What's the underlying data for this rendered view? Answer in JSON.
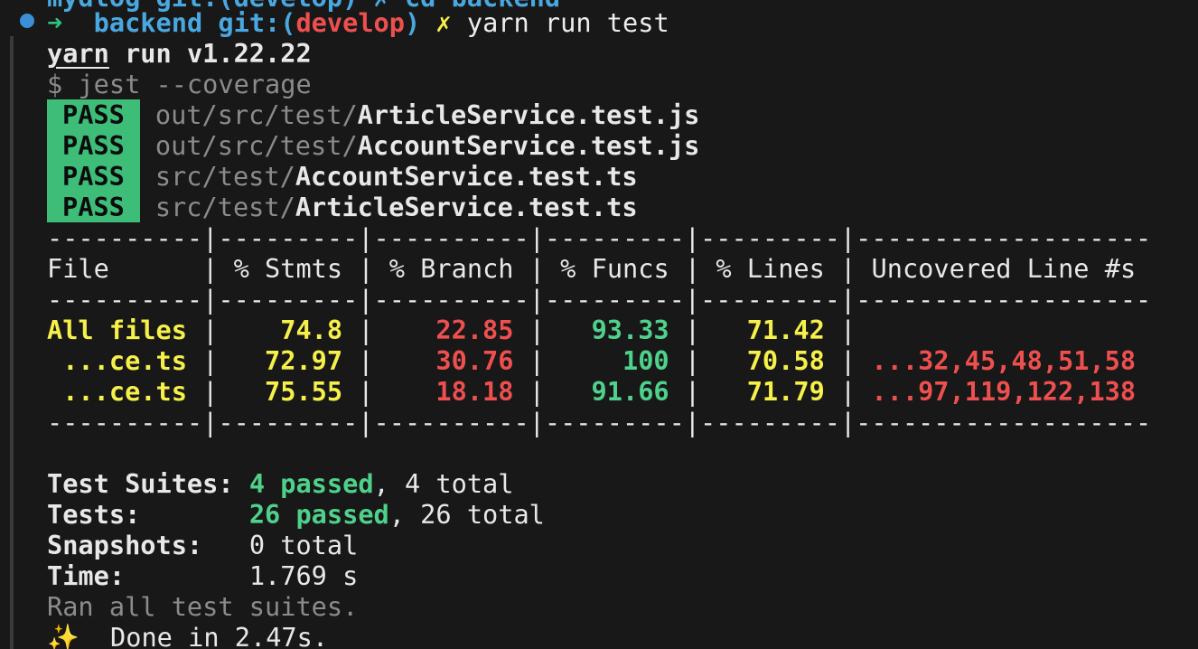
{
  "prev_command": "mydlog git:(develop) ✗ cd backend",
  "prompt": {
    "arrow": "➜",
    "dir": "backend",
    "git_label": "git:(",
    "branch": "develop",
    "git_close": ")",
    "dirty": "✗",
    "command": "yarn run test"
  },
  "yarn_header": {
    "yarn": "yarn",
    "rest": " run v1.22.22"
  },
  "jest_cmd": "$ jest --coverage",
  "test_results": [
    {
      "status": "PASS",
      "dir": "out/src/test/",
      "file": "ArticleService.test.js"
    },
    {
      "status": "PASS",
      "dir": "out/src/test/",
      "file": "AccountService.test.js"
    },
    {
      "status": "PASS",
      "dir": "src/test/",
      "file": "AccountService.test.ts"
    },
    {
      "status": "PASS",
      "dir": "src/test/",
      "file": "ArticleService.test.ts"
    }
  ],
  "coverage": {
    "separator": "----------|---------|----------|---------|---------|-------------------",
    "headers": [
      "File",
      "% Stmts",
      "% Branch",
      "% Funcs",
      "% Lines",
      "Uncovered Line #s"
    ],
    "rows": [
      {
        "file": "All files",
        "stmts": "74.8",
        "branch": "22.85",
        "funcs": "93.33",
        "lines": "71.42",
        "uncovered": ""
      },
      {
        "file": " ...ce.ts",
        "stmts": "72.97",
        "branch": "30.76",
        "funcs": "100",
        "lines": "70.58",
        "uncovered": "...32,45,48,51,58"
      },
      {
        "file": " ...ce.ts",
        "stmts": "75.55",
        "branch": "18.18",
        "funcs": "91.66",
        "lines": "71.79",
        "uncovered": "...97,119,122,138"
      }
    ]
  },
  "summary": {
    "suites_label": "Test Suites:",
    "suites_passed": "4 passed",
    "suites_total": ", 4 total",
    "tests_label": "Tests:",
    "tests_passed": "26 passed",
    "tests_total": ", 26 total",
    "snapshots_label": "Snapshots:",
    "snapshots_value": "0 total",
    "time_label": "Time:",
    "time_value": "1.769 s",
    "ran_all": "Ran all test suites."
  },
  "done": {
    "icon": "✨",
    "text": "  Done in 2.47s."
  },
  "colors": {
    "pass_bg": "#3dbd78",
    "branch_red": "#ee4f4f",
    "yellow": "#f6f04a",
    "green": "#4fd18b",
    "prompt_cyan": "#4aa8e0"
  }
}
